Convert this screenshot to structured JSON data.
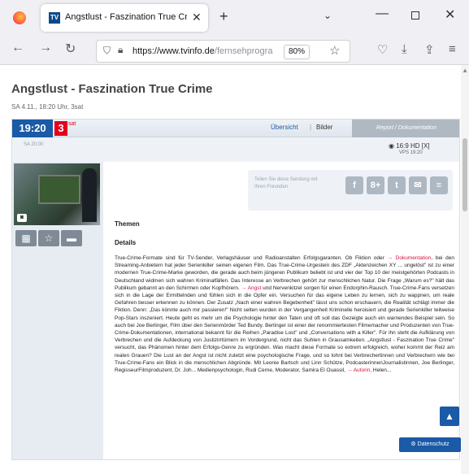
{
  "browser": {
    "tab_title": "Angstlust - Faszination True Cr",
    "tab_favicon": "TV",
    "new_tab": "+",
    "tab_list": "⌄",
    "url_host": "https://www.tvinfo.de",
    "url_path": "/fernsehprogra",
    "zoom": "80%",
    "close_glyph": "✕",
    "min_glyph": "—"
  },
  "page": {
    "title": "Angstlust - Faszination True Crime",
    "subtitle": "SA 4.11., 18:20 Uhr, 3sat"
  },
  "card": {
    "time": "19:20",
    "channel_number": "3",
    "channel_suffix": "sat",
    "link_overview": "Übersicht",
    "separator": "|",
    "link_images": "Bilder",
    "genre": "Report / Dokumentation",
    "date_small": "SA 20:00",
    "hd_badges": "◉ 16:9  HD  [X]",
    "vps": "VPS 19:20"
  },
  "share": {
    "text": "Teilen Sie diese Sendung mit Ihren Freunden",
    "buttons": [
      "f",
      "8+",
      "t",
      "✉",
      "≡"
    ]
  },
  "sections": {
    "themen": "Themen",
    "details": "Details"
  },
  "body": {
    "p1": "True-Crime-Formate sind für TV-Sender, Verlagshäuser und Radioanstalten Erfolgsgaranten. Ob Fiktion oder ",
    "link1": "→ Dokumentation",
    "p2": ", bei den Streaming-Anbietern hat jeder Serienkiller seinen eigenen Film. Das True-Crime-Urgestein des ZDF „Aktenzeichen XY ... ungelöst\" ist zu einer modernen True-Crime-Marke geworden, die gerade auch beim jüngeren Publikum beliebt ist und vier der Top 10 der meistgehörten Podcasts in Deutschland widmen sich wahren Kriminalfällen. Das Interesse an Verbrechen gehört zur menschlichen Natur. Die Frage „Warum es?\" hält das Publikum gebannt an den Schirmen oder Kopfhörern. ",
    "link2": "→ Angst",
    "p3": " und Nervenkitzel sorgen für einen Endorphin-Rausch. True-Crime-Fans versetzen sich in die Lage der Ermittelnden und fühlen sich in die Opfer ein. Versuchen für das eigene Leben zu lernen, sich zu wappnen, um reale Gefahren besser erkennen zu können. Der Zusatz „Nach einer wahren Begebenheit\" lässt uns schon erschauern, die Realität schlägt immer die Fiktion. Denn: „Das könnte auch mir passieren!\" Nicht selten wurden in der Vergangenheit Kriminelle heroisiert und gerade Serienkiller teilweise Pop-Stars inszeniert. Heute geht es mehr um die Psychologie hinter den Taten und oft soll das Gezeigte auch ein warnendes Beispiel sein. So auch bei Joe Berlinger, Film über den Serienmörder Ted Bundy. Berlinger ist einer der renommiertesten Filmemacher und Produzenten von True-Crime-Dokumentationen, international bekannt für die Reihen „Paradise Lost\" und „Conversations with a Killer\". Für ihn steht die Aufklärung von Verbrechen und die Aufdeckung von Justizirrtümern im Vordergrund, nicht das Suhlen in Grausamkeiten. „Angstlust - Faszination True Crime\" versucht, das Phänomen hinter dem Erfolgs-Genre zu ergründen. Was macht diese Formate so extrem erfolgreich, woher kommt der Reiz am realen Grauen? Die Lust an der Angst ist nicht zuletzt eine psychologische Frage, und so lohnt bei Verbrechertinnen und Verbrechern wie bei True-Crime-Fans ein Blick in die menschlichen Abgründe. Mit Leonie Bartsch und Linn Schütze, PodcasterinnenJournalistinnen, Joe Berlinger, RegisseurFilmproduzent, Dr. Joh... Medienpsychologin, Rudi Cerne, Moderator, Samira El Ouassil, ",
    "link3": "→ Autorin",
    "p4": ", Helen..."
  },
  "widgets": {
    "privacy": "Datenschutz",
    "up": "▲"
  }
}
